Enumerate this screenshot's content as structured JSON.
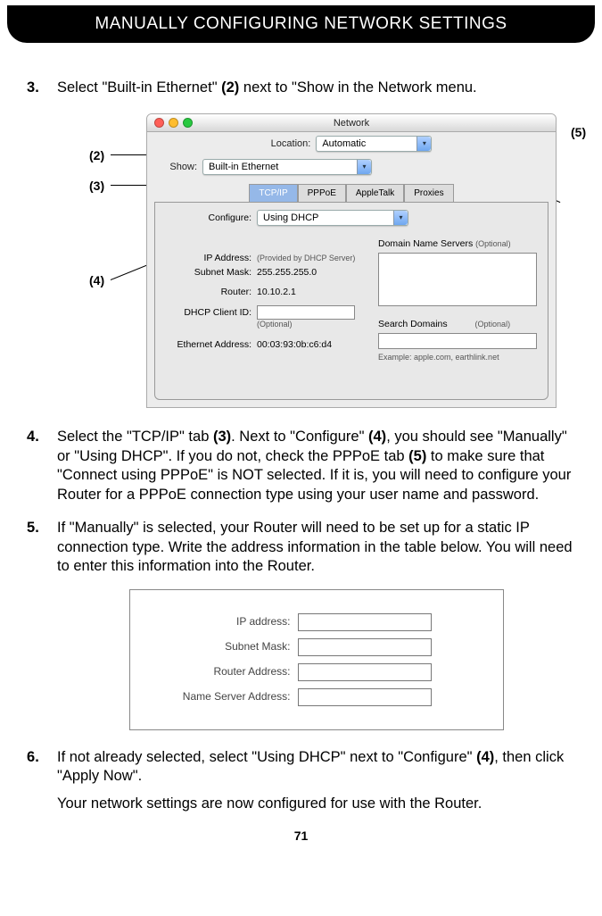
{
  "header": "MANUALLY CONFIGURING NETWORK SETTINGS",
  "steps": {
    "s3": {
      "prefix": "Select \"Built-in Ethernet\" ",
      "bold1": "(2)",
      "suffix": " next to \"Show in the Network menu."
    },
    "s4": {
      "t1": "Select the \"TCP/IP\" tab ",
      "b1": "(3)",
      "t2": ". Next to \"Configure\" ",
      "b2": "(4)",
      "t3": ", you should see \"Manually\" or \"Using DHCP\". If you do not, check the PPPoE tab ",
      "b3": "(5)",
      "t4": " to make sure that \"Connect using PPPoE\" is NOT selected. If it is, you will need to configure your Router for a PPPoE connection type using your user name and password."
    },
    "s5": "If \"Manually\" is selected, your Router will need to be set up for a static IP connection type. Write the address information in the table below. You will need to enter this information into the Router.",
    "s6": {
      "t1": "If not already selected, select  \"Using DHCP\" next to \"Configure\" ",
      "b1": "(4)",
      "t2": ", then click \"Apply Now\".",
      "sub": "Your network settings are now configured for use with the Router."
    }
  },
  "callouts": {
    "c2": "(2)",
    "c3": "(3)",
    "c4": "(4)",
    "c5": "(5)"
  },
  "mac": {
    "title": "Network",
    "location_label": "Location:",
    "location_val": "Automatic",
    "show_label": "Show:",
    "show_val": "Built-in Ethernet",
    "tabs": {
      "tcp": "TCP/IP",
      "pppoe": "PPPoE",
      "apple": "AppleTalk",
      "proxies": "Proxies"
    },
    "configure_label": "Configure:",
    "configure_val": "Using DHCP",
    "ip_label": "IP Address:",
    "ip_note": "(Provided by DHCP Server)",
    "subnet_label": "Subnet Mask:",
    "subnet_val": "255.255.255.0",
    "router_label": "Router:",
    "router_val": "10.10.2.1",
    "dhcpid_label": "DHCP Client ID:",
    "dhcpid_note": "(Optional)",
    "eth_label": "Ethernet Address:",
    "eth_val": "00:03:93:0b:c6:d4",
    "dns_label": "Domain Name Servers",
    "dns_opt": "(Optional)",
    "search_label": "Search Domains",
    "search_opt": "(Optional)",
    "example": "Example: apple.com, earthlink.net"
  },
  "form": {
    "ip": "IP address:",
    "subnet": "Subnet Mask:",
    "router": "Router Address:",
    "dns": "Name Server Address:"
  },
  "page": "71"
}
